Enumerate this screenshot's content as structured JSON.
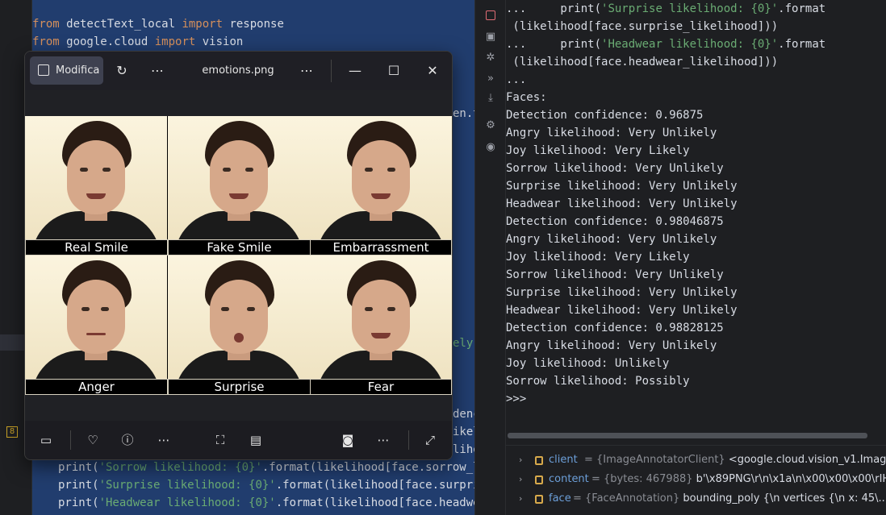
{
  "editor": {
    "line1": {
      "kw1": "from",
      "mod": " detectText_local ",
      "kw2": "import",
      "name": " response"
    },
    "line2": {
      "kw1": "from",
      "mod": " google.cloud ",
      "kw2": "import",
      "name": " vision"
    },
    "frag_a": "en.t",
    "frag_b": "ely",
    "frag_c": "denc",
    "frag_d": "ikel",
    "frag_e": "lihoo",
    "frag_f": "ood",
    "bottom_lines": [
      {
        "fn": "print(",
        "s": "'Sorrow likelihood: {0}'",
        "rest": ".format(likelihood[face.sorrow_like"
      },
      {
        "fn": "print(",
        "s": "'Surprise likelihood: {0}'",
        "rest": ".format(likelihood[face.surprise_"
      },
      {
        "fn": "print(",
        "s": "'Headwear likelihood: {0}'",
        "rest": ".format(likelihood[face.headwear_"
      }
    ],
    "gutter_badge": "8"
  },
  "viewer": {
    "edit_label": "Modifica",
    "filename": "emotions.png",
    "captions": [
      "Real Smile",
      "Fake Smile",
      "Embarrassment",
      "Anger",
      "Surprise",
      "Fear"
    ]
  },
  "console": {
    "lines": [
      {
        "pre": "...     print(",
        "str": "'Surprise likelihood: {0}'",
        "post": ".format"
      },
      {
        "pre": " (likelihood[face.surprise_likelihood]))",
        "str": "",
        "post": ""
      },
      {
        "pre": "...     print(",
        "str": "'Headwear likelihood: {0}'",
        "post": ".format"
      },
      {
        "pre": " (likelihood[face.headwear_likelihood]))",
        "str": "",
        "post": ""
      },
      {
        "pre": "...",
        "str": "",
        "post": ""
      },
      {
        "pre": "Faces:",
        "str": "",
        "post": ""
      },
      {
        "pre": "Detection confidence: 0.96875",
        "str": "",
        "post": ""
      },
      {
        "pre": "Angry likelihood: Very Unlikely",
        "str": "",
        "post": ""
      },
      {
        "pre": "Joy likelihood: Very Likely",
        "str": "",
        "post": ""
      },
      {
        "pre": "Sorrow likelihood: Very Unlikely",
        "str": "",
        "post": ""
      },
      {
        "pre": "Surprise likelihood: Very Unlikely",
        "str": "",
        "post": ""
      },
      {
        "pre": "Headwear likelihood: Very Unlikely",
        "str": "",
        "post": ""
      },
      {
        "pre": "Detection confidence: 0.98046875",
        "str": "",
        "post": ""
      },
      {
        "pre": "Angry likelihood: Very Unlikely",
        "str": "",
        "post": ""
      },
      {
        "pre": "Joy likelihood: Very Likely",
        "str": "",
        "post": ""
      },
      {
        "pre": "Sorrow likelihood: Very Unlikely",
        "str": "",
        "post": ""
      },
      {
        "pre": "Surprise likelihood: Very Unlikely",
        "str": "",
        "post": ""
      },
      {
        "pre": "Headwear likelihood: Very Unlikely",
        "str": "",
        "post": ""
      },
      {
        "pre": "Detection confidence: 0.98828125",
        "str": "",
        "post": ""
      },
      {
        "pre": "Angry likelihood: Very Unlikely",
        "str": "",
        "post": ""
      },
      {
        "pre": "Joy likelihood: Unlikely",
        "str": "",
        "post": ""
      },
      {
        "pre": "Sorrow likelihood: Possibly",
        "str": "",
        "post": ""
      },
      {
        "pre": ">>>",
        "str": "",
        "post": ""
      }
    ]
  },
  "variables": [
    {
      "name": "client",
      "type": " = {ImageAnnotatorClient}",
      "value": " <google.cloud.vision_v1.ImageAnnotatorClient"
    },
    {
      "name": "content",
      "type": " = {bytes: 467988}",
      "value": " b'\\x89PNG\\r\\n\\x1a\\n\\x00\\x00\\x00\\rIHDR"
    },
    {
      "name": "face",
      "type": " = {FaceAnnotation}",
      "value": " bounding_poly {\\n  vertices {\\n    x: 45\\..."
    }
  ],
  "icons": {
    "toolstrip": [
      "stop-icon",
      "rerun-icon",
      "debug-icon",
      "expand-icon",
      "scroll-end-icon",
      "settings-icon",
      "eye-icon"
    ],
    "viewer_top": [
      "edit-icon",
      "rotate-icon",
      "more-icon",
      "more-icon",
      "minimize-icon",
      "maximize-icon",
      "close-icon"
    ],
    "viewer_bottom": [
      "filmstrip-icon",
      "heart-icon",
      "info-icon",
      "more-icon",
      "crop-icon",
      "ocr-icon",
      "slideshow-icon",
      "more-icon",
      "fullscreen-icon"
    ]
  }
}
